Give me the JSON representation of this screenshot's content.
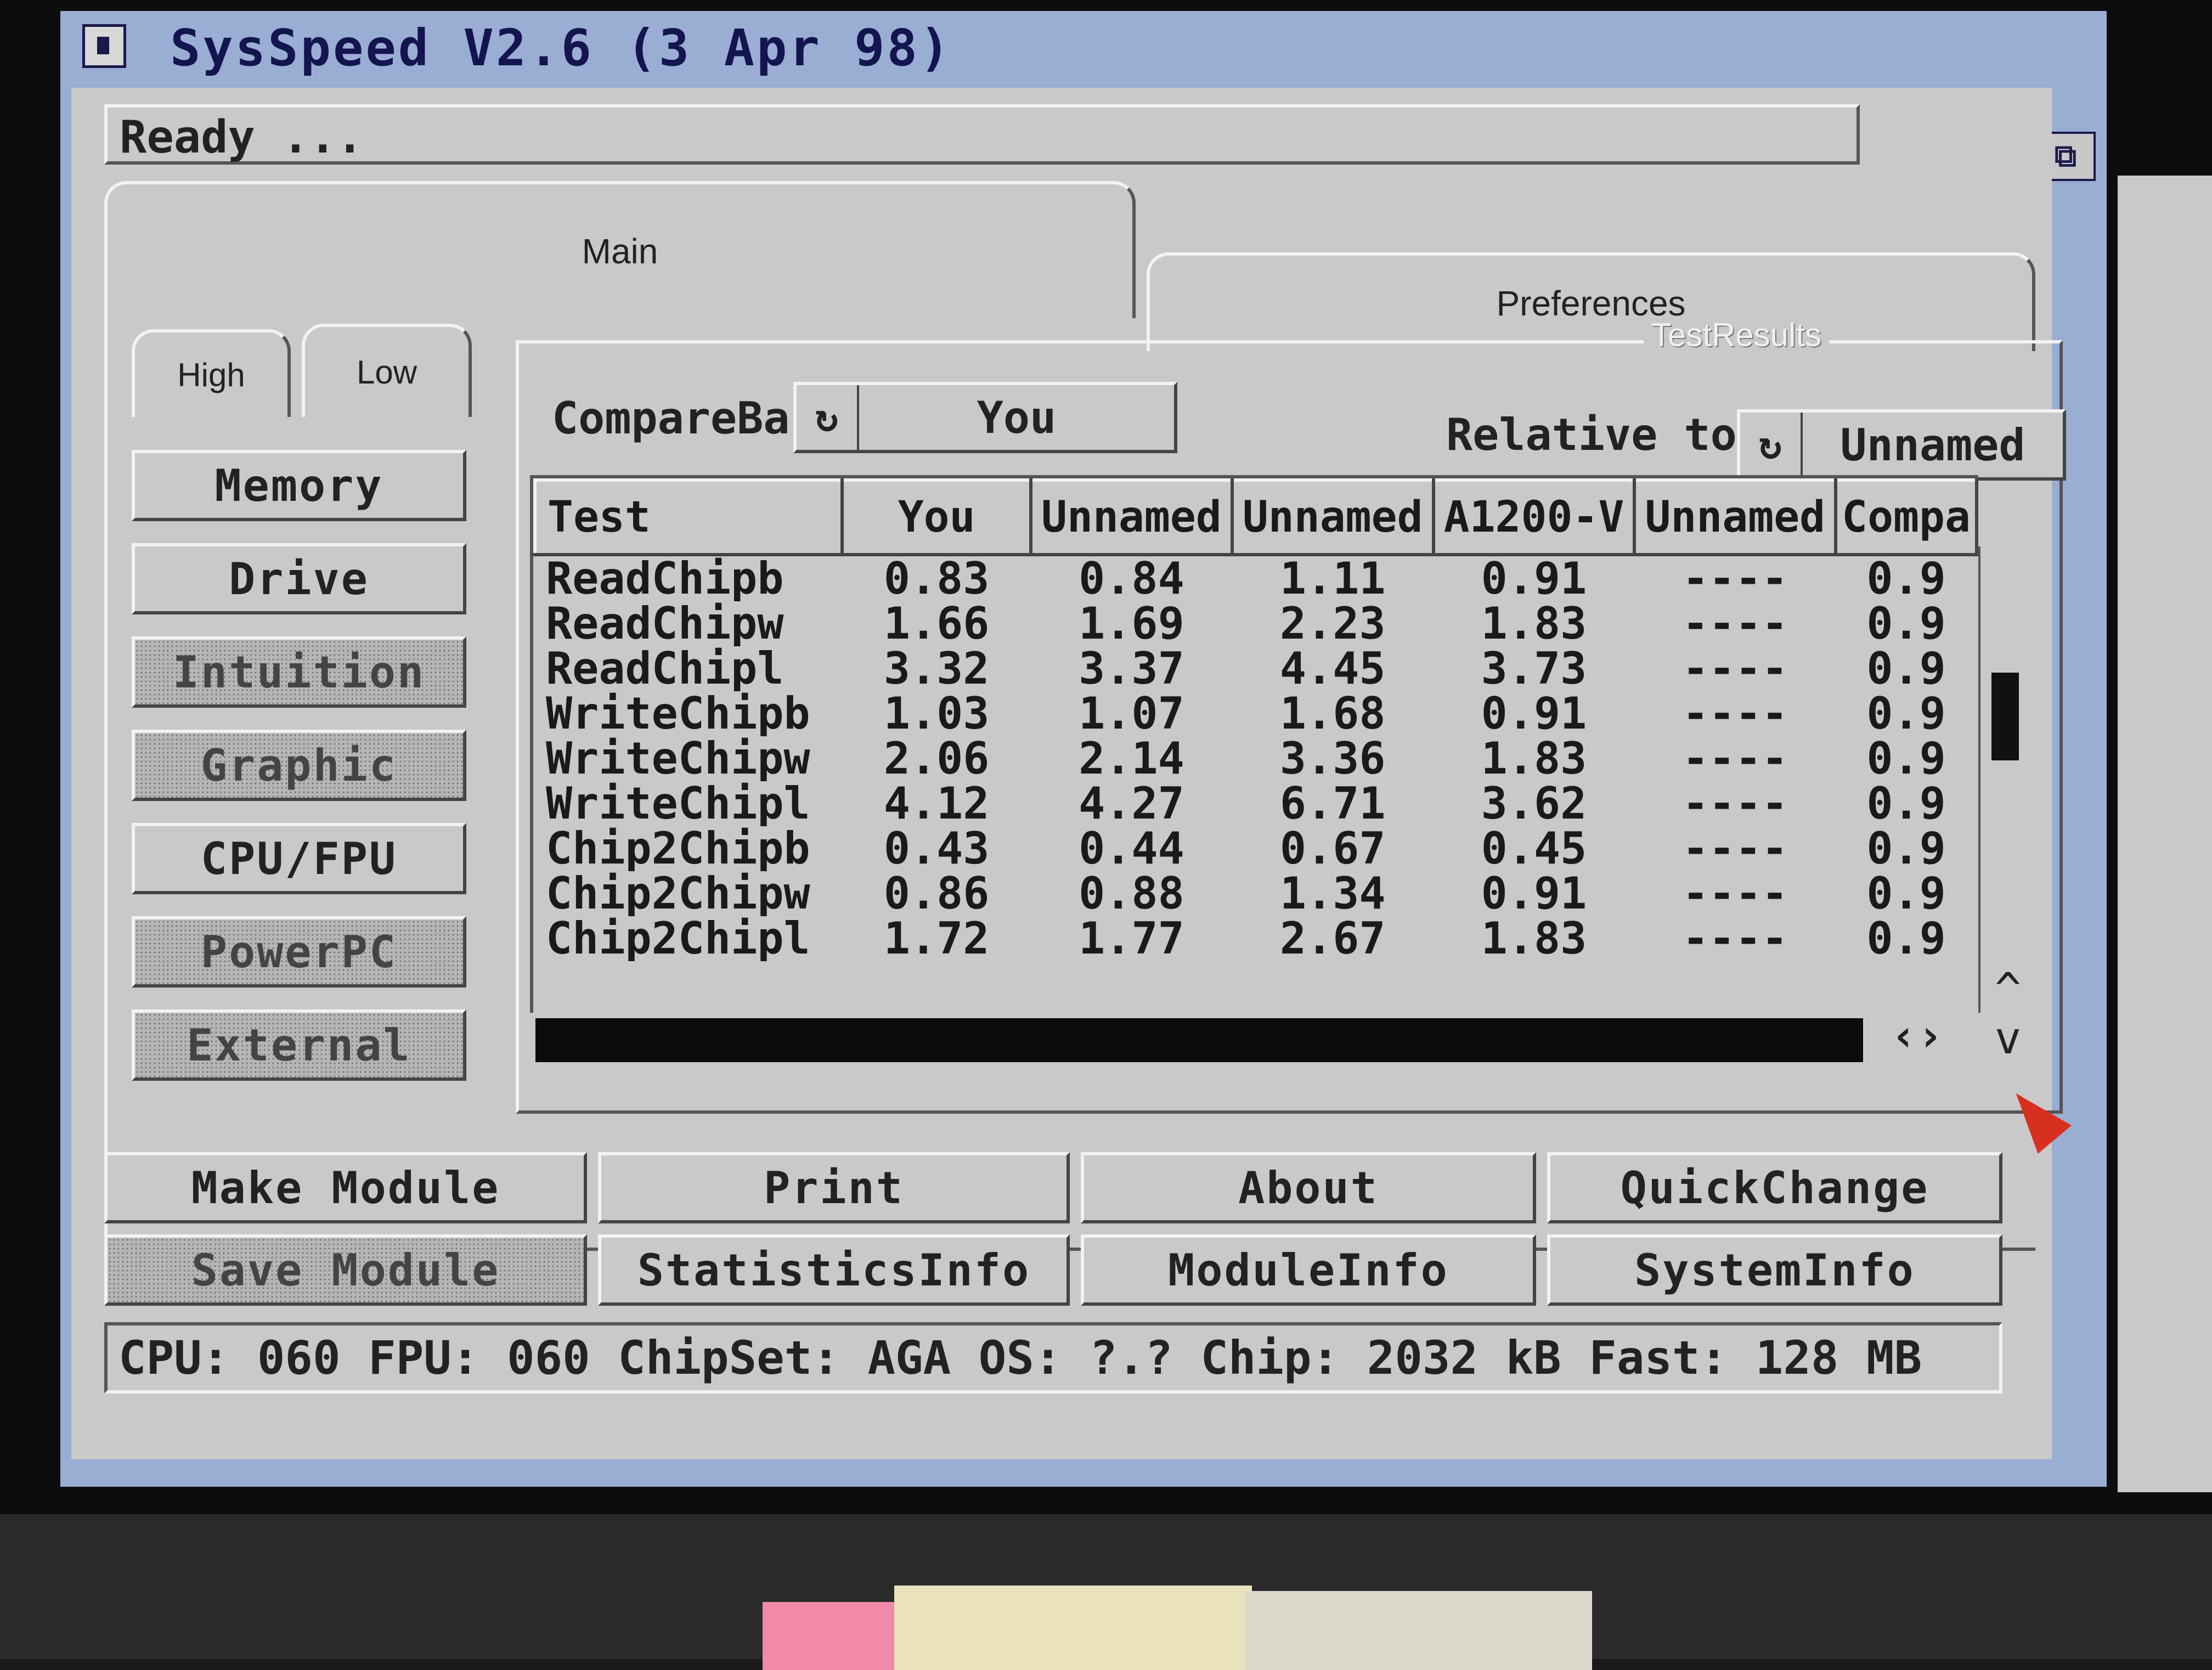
{
  "window": {
    "title": "SysSpeed  V2.6 (3 Apr 98)",
    "status": "Ready ..."
  },
  "tabs": {
    "main": "Main",
    "preferences": "Preferences"
  },
  "subtabs": {
    "high": "High",
    "low": "Low"
  },
  "sidebar": [
    {
      "label": "Memory",
      "disabled": false
    },
    {
      "label": "Drive",
      "disabled": false
    },
    {
      "label": "Intuition",
      "disabled": true
    },
    {
      "label": "Graphic",
      "disabled": true
    },
    {
      "label": "CPU/FPU",
      "disabled": false
    },
    {
      "label": "PowerPC",
      "disabled": true
    },
    {
      "label": "External",
      "disabled": true
    }
  ],
  "results": {
    "group_label": "TestResults",
    "compare_base_label": "CompareBase",
    "compare_base_value": "You",
    "relative_label": "Relative to",
    "relative_value": "Unnamed",
    "columns": [
      "Test",
      "You",
      "Unnamed",
      "Unnamed",
      "A1200-V",
      "Unnamed",
      "Compa"
    ],
    "rows": [
      [
        "ReadChipb",
        "0.83",
        "0.84",
        "1.11",
        "0.91",
        "----",
        "0.9"
      ],
      [
        "ReadChipw",
        "1.66",
        "1.69",
        "2.23",
        "1.83",
        "----",
        "0.9"
      ],
      [
        "ReadChipl",
        "3.32",
        "3.37",
        "4.45",
        "3.73",
        "----",
        "0.9"
      ],
      [
        "WriteChipb",
        "1.03",
        "1.07",
        "1.68",
        "0.91",
        "----",
        "0.9"
      ],
      [
        "WriteChipw",
        "2.06",
        "2.14",
        "3.36",
        "1.83",
        "----",
        "0.9"
      ],
      [
        "WriteChipl",
        "4.12",
        "4.27",
        "6.71",
        "3.62",
        "----",
        "0.9"
      ],
      [
        "Chip2Chipb",
        "0.43",
        "0.44",
        "0.67",
        "0.45",
        "----",
        "0.9"
      ],
      [
        "Chip2Chipw",
        "0.86",
        "0.88",
        "1.34",
        "0.91",
        "----",
        "0.9"
      ],
      [
        "Chip2Chipl",
        "1.72",
        "1.77",
        "2.67",
        "1.83",
        "----",
        "0.9"
      ]
    ]
  },
  "buttons": {
    "make_module": "Make Module",
    "print": "Print",
    "about": "About",
    "quickchange": "QuickChange",
    "save_module": "Save Module",
    "statistics_info": "StatisticsInfo",
    "module_info": "ModuleInfo",
    "system_info": "SystemInfo"
  },
  "info": "CPU: 060  FPU: 060  ChipSet: AGA  OS: ?.?  Chip: 2032 kB  Fast: 128 MB"
}
